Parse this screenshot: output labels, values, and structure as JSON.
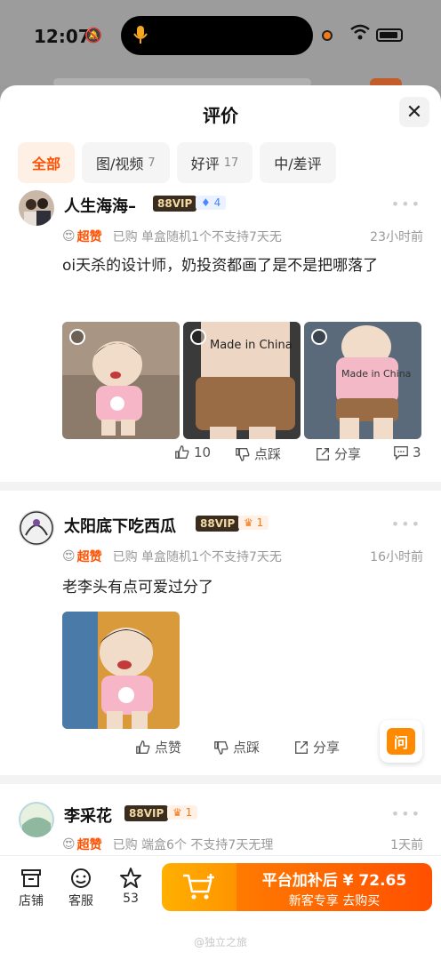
{
  "status": {
    "time": "12:07"
  },
  "sheet": {
    "title": "评价"
  },
  "tabs": [
    {
      "label": "全部",
      "count": ""
    },
    {
      "label": "图/视频",
      "count": "7"
    },
    {
      "label": "好评",
      "count": "17"
    },
    {
      "label": "中/差评",
      "count": ""
    }
  ],
  "reviews": [
    {
      "username": "人生海海–",
      "vip": "88VIP",
      "level": "4",
      "rating": "超赞",
      "spec": "已购 单盒随机1个不支持7天无",
      "time": "23小时前",
      "text": "oi天杀的设计师，奶投资都画了是不是把哪落了",
      "likes": "10",
      "dislike": "点踩",
      "share": "分享",
      "comments": "3",
      "photo_texts": [
        "Made in China",
        "Made in China"
      ]
    },
    {
      "username": "太阳底下吃西瓜",
      "vip": "88VIP",
      "level": "1",
      "rating": "超赞",
      "spec": "已购 单盒随机1个不支持7天无",
      "time": "16小时前",
      "text": "老李头有点可爱过分了",
      "likes": "点赞",
      "dislike": "点踩",
      "share": "分享"
    },
    {
      "username": "李采花",
      "vip": "88VIP",
      "level": "1",
      "rating": "超赞",
      "spec": "已购 端盒6个 不支持7天无理",
      "time": "1天前"
    }
  ],
  "ask_button": "问",
  "bottom": {
    "store": "店铺",
    "service": "客服",
    "favorites": "53",
    "buy_title": "平台加补后 ¥ 72.65",
    "buy_sub": "新客专享 去购买",
    "watermark": "@独立之旅"
  },
  "colors": {
    "accent": "#ff5000",
    "vip_bg": "#3a2d1f",
    "buy_gradient_start": "#ff7a00"
  }
}
